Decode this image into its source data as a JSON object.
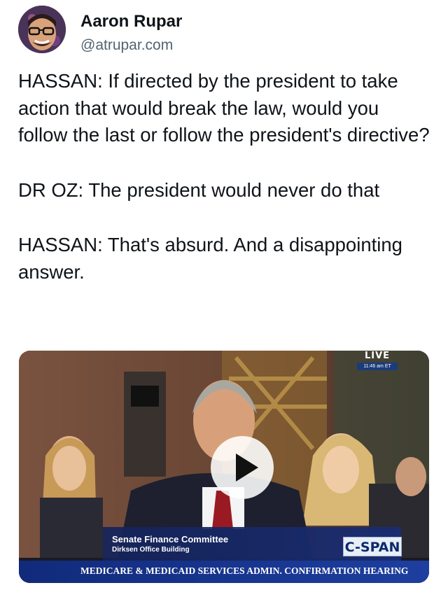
{
  "author": {
    "name": "Aaron Rupar",
    "handle": "@atrupar.com"
  },
  "post": {
    "paragraphs": [
      "HASSAN: If directed by the president to take action that would break the law, would you follow the last or follow the president's directive?",
      "DR OZ: The president would never do that",
      "HASSAN: That's absurd. And a disappointing answer."
    ]
  },
  "video": {
    "live_label": "LIVE",
    "live_time": "11:46 am ET",
    "lower_third_title": "Senate Finance Committee",
    "lower_third_subtitle": "Dirksen Office Building",
    "network_logo": "C-SPAN",
    "hearing_banner": "MEDICARE & MEDICAID SERVICES ADMIN. CONFIRMATION HEARING",
    "play_icon": "play-icon"
  },
  "colors": {
    "text_primary": "#0f1419",
    "text_secondary": "#536471",
    "banner_blue": "#1e3fa0"
  }
}
